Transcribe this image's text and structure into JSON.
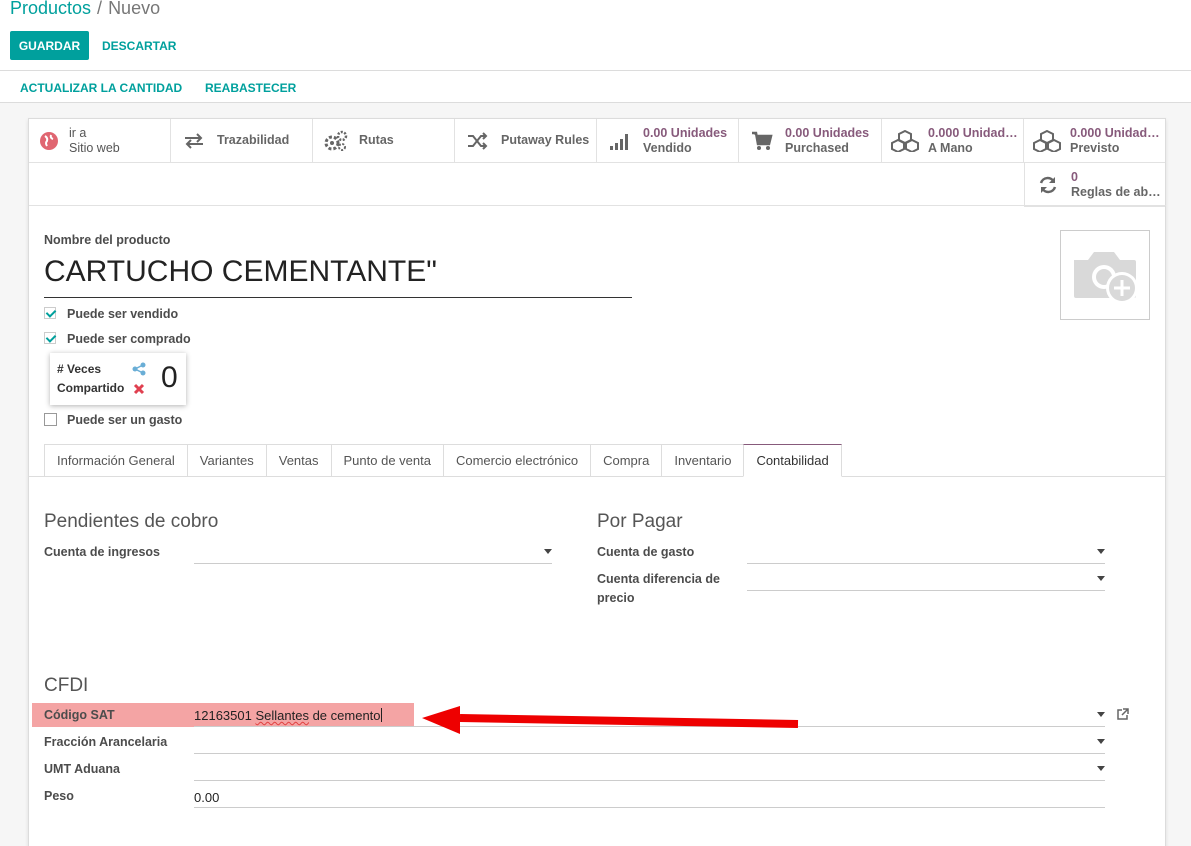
{
  "breadcrumb": {
    "parent": "Productos",
    "separator": "/",
    "current": "Nuevo"
  },
  "toolbar": {
    "save_label": "GUARDAR",
    "discard_label": "DESCARTAR"
  },
  "actions": {
    "update_qty": "ACTUALIZAR LA CANTIDAD",
    "replenish": "REABASTECER"
  },
  "stat_buttons": {
    "website": {
      "line1": "ir a",
      "line2": "Sitio web"
    },
    "traceability": {
      "label": "Trazabilidad"
    },
    "routes": {
      "label": "Rutas"
    },
    "putaway": {
      "label": "Putaway Rules"
    },
    "sold": {
      "value": "0.00 Unidades",
      "label": "Vendido"
    },
    "purchased": {
      "value": "0.00 Unidades",
      "label": "Purchased"
    },
    "on_hand": {
      "value": "0.000 Unidad…",
      "label": "A Mano"
    },
    "forecast": {
      "value": "0.000 Unidad…",
      "label": "Previsto"
    },
    "reorder": {
      "value": "0",
      "label": "Reglas de ab…"
    }
  },
  "product": {
    "name_label": "Nombre del producto",
    "name": "CARTUCHO CEMENTANTE\"",
    "can_be_sold": "Puede ser vendido",
    "can_be_purchased": "Puede ser comprado",
    "can_be_expensed": "Puede ser un gasto",
    "share_label_1": "# Veces",
    "share_label_2": "Compartido",
    "share_count": "0"
  },
  "tabs": [
    {
      "label": "Información General"
    },
    {
      "label": "Variantes"
    },
    {
      "label": "Ventas"
    },
    {
      "label": "Punto de venta"
    },
    {
      "label": "Comercio electrónico"
    },
    {
      "label": "Compra"
    },
    {
      "label": "Inventario"
    },
    {
      "label": "Contabilidad"
    }
  ],
  "receivables": {
    "title": "Pendientes de cobro",
    "income_account_label": "Cuenta de ingresos"
  },
  "payables": {
    "title": "Por Pagar",
    "expense_account_label": "Cuenta de gasto",
    "price_diff_label_1": "Cuenta diferencia de",
    "price_diff_label_2": "precio"
  },
  "cfdi": {
    "title": "CFDI",
    "sat_code_label": "Código SAT",
    "sat_code_number": "12163501",
    "sat_code_word": "Sellantes",
    "sat_code_rest": "de cemento",
    "tariff_label": "Fracción Arancelaria",
    "umt_label": "UMT Aduana",
    "weight_label": "Peso",
    "weight_value": "0.00"
  },
  "colors": {
    "brand": "#00a09d",
    "accent": "#875a7b",
    "annotation_arrow": "#ee0000",
    "highlight": "#f4a4a4"
  }
}
